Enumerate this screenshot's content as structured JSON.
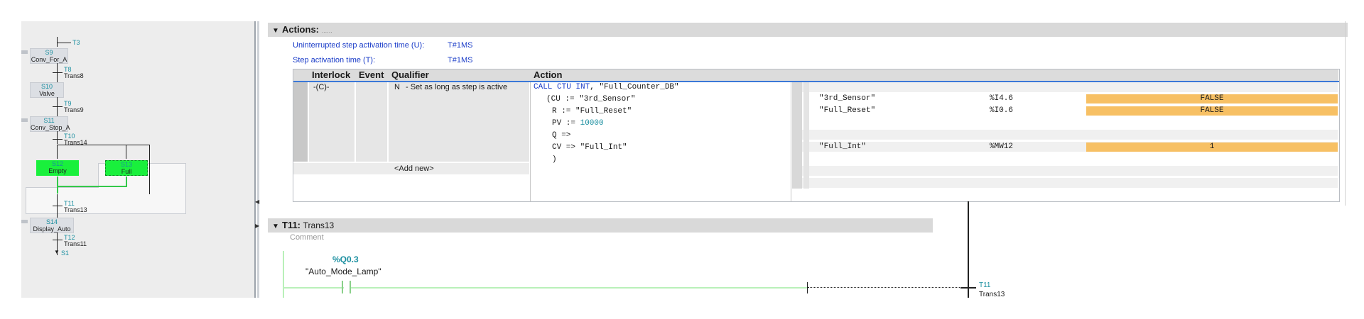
{
  "navigator": {
    "top_transition": "T3",
    "steps": [
      {
        "num": "S9",
        "name": "Conv_For_A"
      },
      {
        "num": "S10",
        "name": "Valve"
      },
      {
        "num": "S11",
        "name": "Conv_Stop_A"
      },
      {
        "num": "S12",
        "name": "Empty"
      },
      {
        "num": "S13",
        "name": "Full"
      },
      {
        "num": "S14",
        "name": "Display_Auto"
      }
    ],
    "transitions": [
      {
        "num": "T8",
        "name": "Trans8"
      },
      {
        "num": "T9",
        "name": "Trans9"
      },
      {
        "num": "T10",
        "name": "Trans14"
      },
      {
        "num": "T11",
        "name": "Trans13"
      },
      {
        "num": "T12",
        "name": "Trans11"
      }
    ],
    "jump_target": "S1"
  },
  "actions": {
    "header": "Actions:",
    "header_sub": "......",
    "u_label": "Uninterrupted step activation time (U):",
    "u_value": "T#1MS",
    "t_label": "Step activation time (T):",
    "t_value": "T#1MS",
    "columns": [
      "Interlock",
      "Event",
      "Qualifier",
      "Action"
    ],
    "row": {
      "interlock": "-(C)-",
      "qualifier_code": "N",
      "qualifier_text": "- Set as long as step is active"
    },
    "add_new": "<Add new>",
    "code": {
      "l1_kw": "CALL CTU INT",
      "l1_rest": ", \"Full_Counter_DB\"",
      "l2": "(CU := \"3rd_Sensor\"",
      "l3": "R := \"Full_Reset\"",
      "l4_a": "PV := ",
      "l4_b": "10000",
      "l5": "Q =>",
      "l6": "CV => \"Full_Int\"",
      "l7": ")"
    },
    "watch": [
      {
        "tag": "\"3rd_Sensor\"",
        "addr": "%I4.6",
        "value": "FALSE"
      },
      {
        "tag": "\"Full_Reset\"",
        "addr": "%I0.6",
        "value": "FALSE"
      },
      {
        "tag": "\"Full_Int\"",
        "addr": "%MW12",
        "value": "1"
      }
    ]
  },
  "transition": {
    "header": "T11:",
    "header_name": "Trans13",
    "comment": "Comment",
    "contact_addr": "%Q0.3",
    "contact_tag": "\"Auto_Mode_Lamp\"",
    "end_num": "T11",
    "end_name": "Trans13"
  },
  "colors": {
    "active_step": "#19f03c",
    "watch_highlight": "#f7c064",
    "link_blue": "#1a3cc8",
    "teal": "#1b8fa0"
  }
}
